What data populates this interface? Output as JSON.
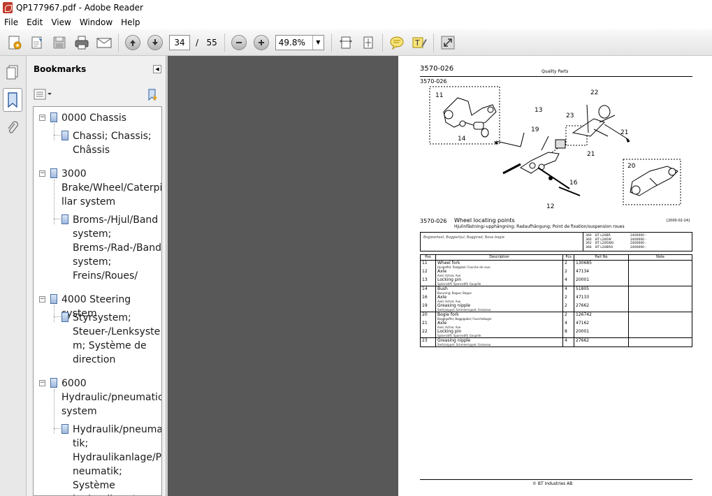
{
  "window": {
    "title": "QP177967.pdf - Adobe Reader"
  },
  "menu": [
    "File",
    "Edit",
    "View",
    "Window",
    "Help"
  ],
  "toolbar": {
    "page_current": "34",
    "page_separator": "/",
    "page_total": "55",
    "zoom": "49.8%"
  },
  "bookmarks": {
    "header": "Bookmarks",
    "items": [
      {
        "label": "0000 Chassis",
        "lines": [
          "0000 Chassis"
        ],
        "level": 0
      },
      {
        "label": "Chassi; Chassis; Châssis",
        "lines": [
          "Chassi; Chassis;",
          "Châssis"
        ],
        "level": 1
      },
      {
        "label": "3000 Brake/Wheel/Caterpillar system",
        "lines": [
          "3000",
          "Brake/Wheel/Caterpi",
          "llar system"
        ],
        "level": 0
      },
      {
        "label": "Broms-/Hjul/Band system; Brems-/Rad-/Band system; Freins/Roues/",
        "lines": [
          "Broms-/Hjul/Band",
          "system;",
          "Brems-/Rad-/Band",
          "system;",
          "Freins/Roues/"
        ],
        "level": 1
      },
      {
        "label": "4000 Steering system",
        "lines": [
          "4000 Steering system"
        ],
        "level": 0
      },
      {
        "label": "Styrsystem; Steuer-/Lenksystem; Système de direction",
        "lines": [
          "Styrsystem;",
          "Steuer-/Lenksyste",
          "m; Système de",
          "direction"
        ],
        "level": 1
      },
      {
        "label": "6000 Hydraulic/pneumatic system",
        "lines": [
          "6000",
          "Hydraulic/pneumatic",
          "system"
        ],
        "level": 0
      },
      {
        "label": "Hydraulik/pneumatik; Hydraulikanlage/Pneumatik; Système hydraulique/pneu",
        "lines": [
          "Hydraulik/pneuma",
          "tik;",
          "Hydraulikanlage/P",
          "neumatik; Système",
          "hydraulique/pneu"
        ],
        "level": 1
      }
    ]
  },
  "pdf": {
    "section": "3570-026",
    "header_center": "Quality Parts",
    "figure_label": "3570-026",
    "callouts": [
      "11",
      "13",
      "14",
      "19",
      "22",
      "23",
      "21",
      "21",
      "20",
      "16",
      "12"
    ],
    "subtitle_code": "3570-026",
    "subtitle": "Wheel locating points",
    "date": "[2000-02-24]",
    "subtitle_translations": "Hjulinfästning/-upphängning; Radaufhängung; Point de fixation/suspension roues",
    "variant_desc": "Bogiewheel; Boggiehjul; Boggirad; Roue bogie",
    "models": [
      {
        "n": "360",
        "model": "BT L20BR",
        "serial": "2400000 -"
      },
      {
        "n": "360",
        "model": "BT L20EW",
        "serial": "2400000 -"
      },
      {
        "n": "362",
        "model": "BT L20EWO",
        "serial": "2400000 -"
      },
      {
        "n": "366",
        "model": "BT L20BRO",
        "serial": "2400000 -"
      }
    ],
    "table_headers": [
      "Pos",
      "Description",
      "Pcs",
      "Part No",
      "Note"
    ],
    "parts": [
      {
        "pos": "11",
        "desc": "Wheel fork",
        "trans": "Hjulgaffel; Radgabel; Fourche de roue",
        "pcs": "2",
        "part": "130685",
        "group_start": true
      },
      {
        "pos": "12",
        "desc": "Axle",
        "trans": "Axel; Achse; Axe",
        "pcs": "2",
        "part": "47134"
      },
      {
        "pos": "13",
        "desc": "Locking pin",
        "trans": "Spännstift; Spannstift; Goupille",
        "pcs": "4",
        "part": "20001"
      },
      {
        "pos": "14",
        "desc": "Bush",
        "trans": "Bussning; Bague; Bague",
        "pcs": "4",
        "part": "51805",
        "group_start": true
      },
      {
        "pos": "16",
        "desc": "Axle",
        "trans": "Axel; Achse; Axe",
        "pcs": "2",
        "part": "47133"
      },
      {
        "pos": "19",
        "desc": "Greasing nipple",
        "trans": "Smörjnippel; Schmiernippel; Graisseur",
        "pcs": "2",
        "part": "27662"
      },
      {
        "pos": "20",
        "desc": "Bogie fork",
        "trans": "Boggigaffel; Boggigabel; Fourchebogie",
        "pcs": "2",
        "part": "126742",
        "group_start": true
      },
      {
        "pos": "21",
        "desc": "Axle",
        "trans": "Axel; Achse; Axe",
        "pcs": "4",
        "part": "47162"
      },
      {
        "pos": "22",
        "desc": "Locking pin",
        "trans": "Spännstift; Spannstift; Goupille",
        "pcs": "8",
        "part": "20001"
      },
      {
        "pos": "23",
        "desc": "Greasing nipple",
        "trans": "Smörjnippel; Schmiernippel; Graisseur",
        "pcs": "4",
        "part": "27662",
        "group_start": true
      }
    ],
    "footer": "© BT Industries AB"
  }
}
